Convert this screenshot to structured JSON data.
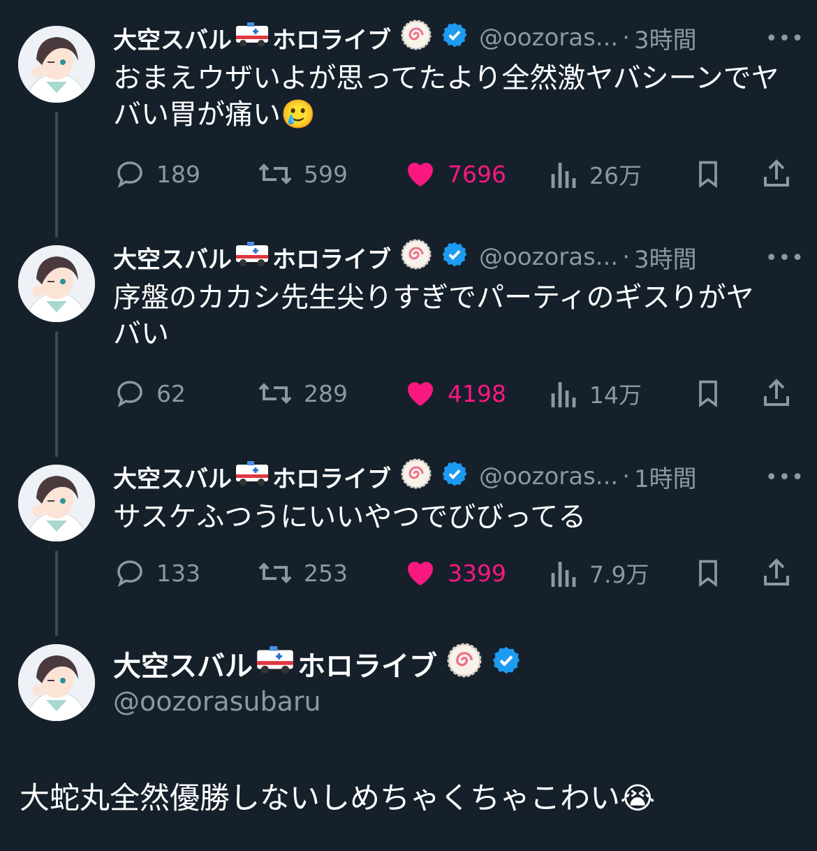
{
  "author": {
    "display_name": "大空スバル",
    "display_name_suffix": "ホロライブ",
    "handle_truncated": "@oozoras...",
    "handle_full": "@oozorasubaru"
  },
  "tweets": [
    {
      "time": "3時間",
      "text": "おまえウザいよが思ってたより全然激ヤバシーンでヤバい胃が痛い",
      "emoji": "🥲",
      "replies": "189",
      "retweets": "599",
      "likes": "7696",
      "views": "26万"
    },
    {
      "time": "3時間",
      "text": "序盤のカカシ先生尖りすぎでパーティのギスりがヤバい",
      "replies": "62",
      "retweets": "289",
      "likes": "4198",
      "views": "14万"
    },
    {
      "time": "1時間",
      "text": "サスケふつうにいいやつでびびってる",
      "replies": "133",
      "retweets": "253",
      "likes": "3399",
      "views": "7.9万"
    }
  ],
  "main_tweet": {
    "text": "大蛇丸全然優勝しないしめちゃくちゃこわい",
    "emoji": "😭"
  },
  "ui": {
    "dot": "·",
    "more": "•••"
  },
  "colors": {
    "background": "#15202b",
    "like": "#f91880",
    "muted": "#8b98a5",
    "verified": "#1d9bf0"
  },
  "icons": [
    "reply-icon",
    "retweet-icon",
    "heart-icon",
    "views-icon",
    "bookmark-icon",
    "share-icon",
    "verified-icon",
    "ambulance-emoji-icon",
    "naruto-emoji-icon",
    "more-icon"
  ]
}
